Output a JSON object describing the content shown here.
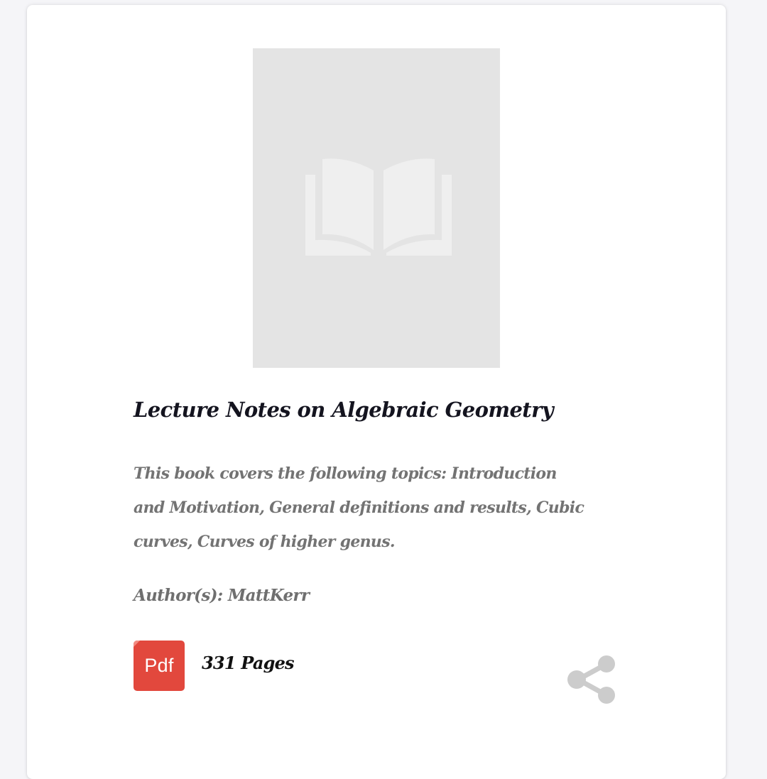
{
  "book": {
    "title": "Lecture Notes on Algebraic Geometry",
    "description": "This book covers the following topics: Introduction and Motivation, General definitions and results, Cubic curves, Curves of higher genus.",
    "author": "Author(s): MattKerr",
    "file_type": "Pdf",
    "pages": "331 Pages"
  },
  "icons": {
    "cover": "open-book-icon",
    "file": "pdf-icon",
    "share": "share-icon"
  },
  "colors": {
    "pdf_badge": "#e2483d",
    "cover_placeholder": "#e4e4e4",
    "share_icon": "#cccccc"
  }
}
